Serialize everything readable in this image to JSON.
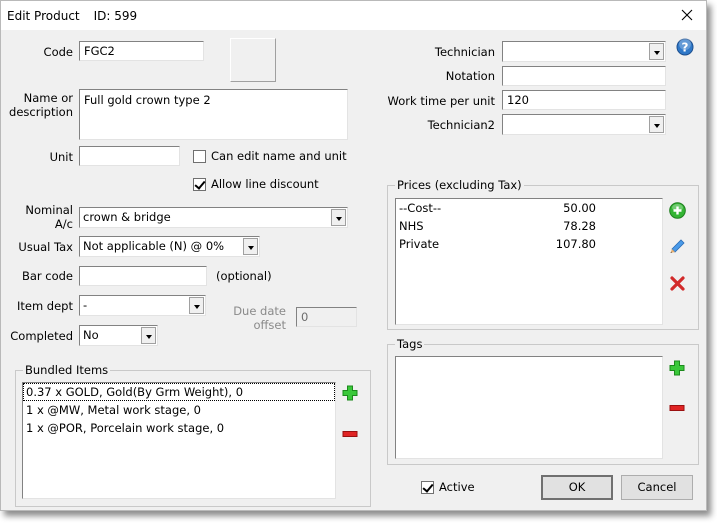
{
  "window": {
    "title": "Edit Product",
    "id_label": "ID: 599",
    "close_icon": "close-icon",
    "help_icon": "help-icon"
  },
  "form": {
    "code": {
      "label": "Code",
      "value": "FGC2"
    },
    "name": {
      "label_line1": "Name or",
      "label_line2": "description",
      "value": "Full gold crown type 2"
    },
    "unit": {
      "label": "Unit",
      "value": ""
    },
    "can_edit_name_unit": {
      "label": "Can edit name and unit",
      "checked": false
    },
    "allow_line_discount": {
      "label": "Allow line discount",
      "checked": true
    },
    "nominal_ac": {
      "label_line1": "Nominal",
      "label_line2": "A/c",
      "value": "crown & bridge"
    },
    "usual_tax": {
      "label": "Usual Tax",
      "value": "Not applicable (N) @ 0%"
    },
    "bar_code": {
      "label": "Bar code",
      "value": "",
      "hint": "(optional)"
    },
    "item_dept": {
      "label": "Item dept",
      "value": "-"
    },
    "due_date_offset": {
      "label_line1": "Due date",
      "label_line2": "offset",
      "value": "0"
    },
    "completed": {
      "label": "Completed",
      "value": "No"
    },
    "technician": {
      "label": "Technician",
      "value": ""
    },
    "notation": {
      "label": "Notation",
      "value": ""
    },
    "work_time": {
      "label": "Work time per unit",
      "value": "120"
    },
    "technician2": {
      "label": "Technician2",
      "value": ""
    }
  },
  "bundled": {
    "title": "Bundled Items",
    "items": [
      "0.37 x GOLD, Gold(By Grm Weight), 0",
      "1 x @MW, Metal work stage, 0",
      "1 x @POR, Porcelain work stage, 0"
    ],
    "add_icon": "plus-icon",
    "remove_icon": "minus-icon"
  },
  "prices": {
    "title": "Prices (excluding Tax)",
    "rows": [
      {
        "name": "--Cost--",
        "value": "50.00"
      },
      {
        "name": "NHS",
        "value": "78.28"
      },
      {
        "name": "Private",
        "value": "107.80"
      }
    ],
    "add_icon": "add-circle-icon",
    "edit_icon": "pencil-icon",
    "delete_icon": "delete-x-icon"
  },
  "tags": {
    "title": "Tags",
    "items": [],
    "add_icon": "plus-icon",
    "remove_icon": "minus-icon"
  },
  "footer": {
    "active": {
      "label": "Active",
      "checked": true
    },
    "ok_label": "OK",
    "cancel_label": "Cancel"
  },
  "colors": {
    "green": "#2fbf2f",
    "red": "#d42020",
    "blue_pencil": "#3f8fe0",
    "help_blue": "#2f78c8"
  }
}
